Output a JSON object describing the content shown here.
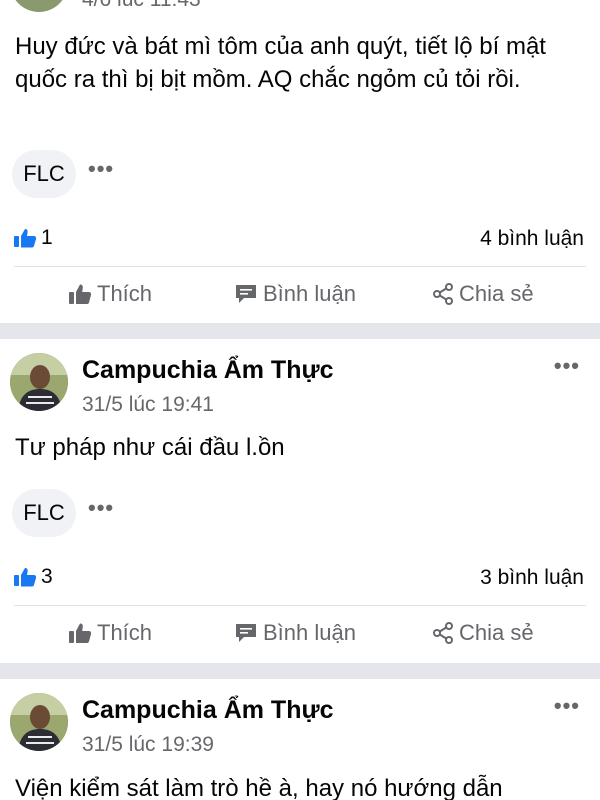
{
  "posts": [
    {
      "time": "4/6 lúc 11:43",
      "text": "Huy đức và bát mì tôm của anh quýt, tiết lộ bí mật quốc ra thì bị bịt mồm. AQ chắc ngỏm củ tỏi rồi.",
      "tag": "FLC",
      "likes": "1",
      "comments": "4 bình luận"
    },
    {
      "author": "Campuchia Ẩm Thực",
      "time": "31/5 lúc 19:41",
      "text": "Tư pháp như cái đầu l.ồn",
      "tag": "FLC",
      "likes": "3",
      "comments": "3 bình luận"
    },
    {
      "author": "Campuchia Ẩm Thực",
      "time": "31/5 lúc 19:39",
      "text": "Viện kiểm sát làm trò hề à, hay nó hướng dẫn"
    }
  ],
  "actions": {
    "like": "Thích",
    "comment": "Bình luận",
    "share": "Chia sẻ"
  },
  "colors": {
    "like_blue": "#1877f2",
    "muted": "#65676b",
    "separator": "#e4e6eb"
  }
}
